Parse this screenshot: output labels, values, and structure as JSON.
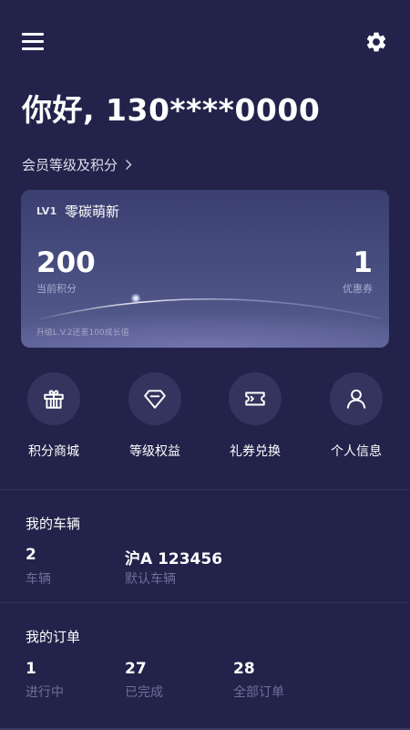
{
  "header": {
    "menu_icon": "hamburger-menu-icon",
    "settings_icon": "gear-icon"
  },
  "greeting": "你好, 130****0000",
  "member_link": {
    "label": "会员等级及积分",
    "icon": "chevron-right-icon"
  },
  "level_card": {
    "badge": "LV1",
    "level_name": "零碳萌新",
    "points_value": "200",
    "points_label": "当前积分",
    "coupon_value": "1",
    "coupon_label": "优惠券",
    "upgrade_note": "升级L.V.2还差100成长值",
    "progress_fraction": 0.67
  },
  "quick_actions": [
    {
      "label": "积分商城",
      "icon": "gift-icon"
    },
    {
      "label": "等级权益",
      "icon": "diamond-icon"
    },
    {
      "label": "礼券兑换",
      "icon": "ticket-icon"
    },
    {
      "label": "个人信息",
      "icon": "user-icon"
    }
  ],
  "vehicles": {
    "title": "我的车辆",
    "count_value": "2",
    "count_label": "车辆",
    "default_value": "沪A 123456",
    "default_label": "默认车辆"
  },
  "orders": {
    "title": "我的订单",
    "items": [
      {
        "value": "1",
        "label": "进行中"
      },
      {
        "value": "27",
        "label": "已完成"
      },
      {
        "value": "28",
        "label": "全部订单"
      }
    ]
  },
  "colors": {
    "background": "#22224a",
    "card": "#4a4f82",
    "icon_circle": "#34345e",
    "muted_text": "#6e6f98"
  }
}
